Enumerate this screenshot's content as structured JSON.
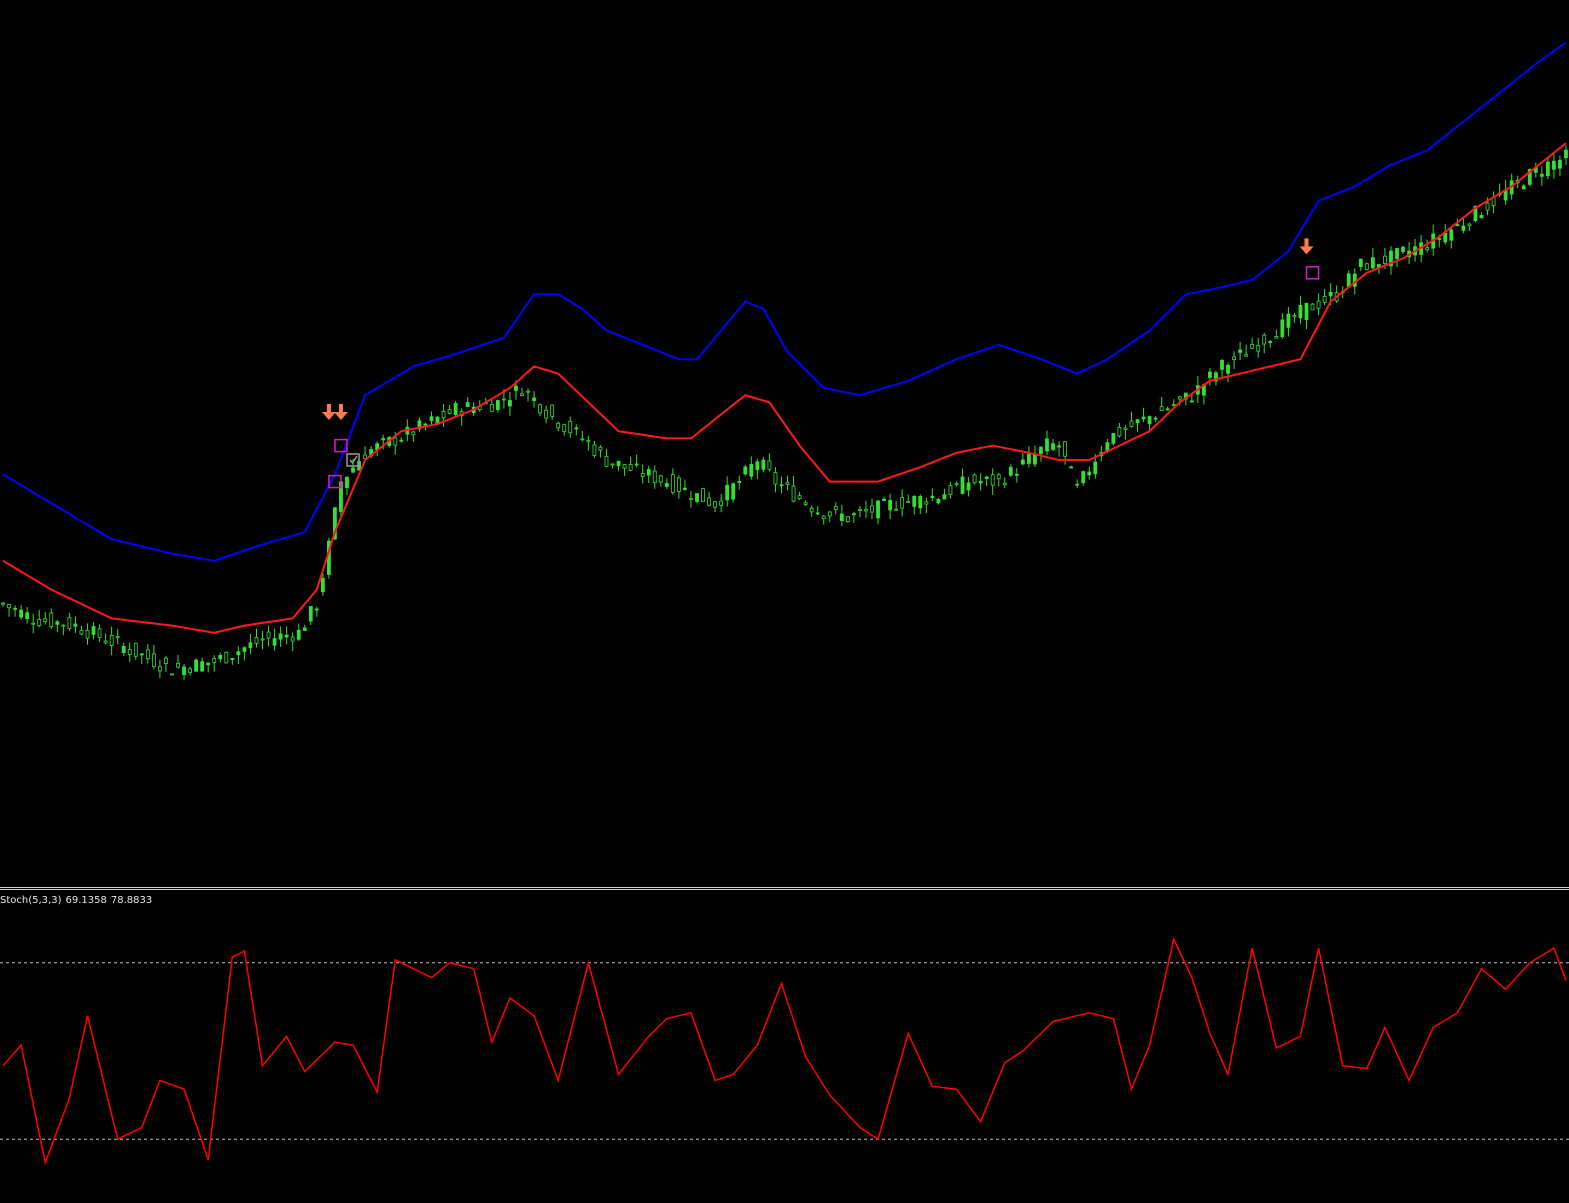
{
  "colors": {
    "background": "#000000",
    "upper_band": "#0000ff",
    "lower_band": "#ff1a1a",
    "candles": "#33e033",
    "sell_arrow": "#ff7a50",
    "marker_magenta": "#d020c8",
    "marker_check": "#9a9a9a",
    "stoch_line": "#ff0000",
    "stoch_levels": "#bfbfbf"
  },
  "stoch_label": {
    "name": "Stoch(5,3,3)",
    "main": "69.1358",
    "signal": "78.8833"
  },
  "chart_data": [
    {
      "type": "candlestick",
      "title": "",
      "grid": false,
      "bar_count": 260,
      "ylim": [
        0,
        100
      ],
      "close_path": [
        [
          0,
          30
        ],
        [
          5,
          28
        ],
        [
          12,
          27
        ],
        [
          20,
          24
        ],
        [
          28,
          21
        ],
        [
          35,
          22
        ],
        [
          43,
          25
        ],
        [
          49,
          26
        ],
        [
          52,
          30
        ],
        [
          54,
          38
        ],
        [
          56,
          47
        ],
        [
          60,
          51
        ],
        [
          68,
          54
        ],
        [
          75,
          57
        ],
        [
          82,
          58
        ],
        [
          86,
          60
        ],
        [
          91,
          56
        ],
        [
          96,
          53
        ],
        [
          100,
          50
        ],
        [
          103,
          49
        ],
        [
          110,
          47
        ],
        [
          115,
          45
        ],
        [
          118,
          44
        ],
        [
          122,
          47
        ],
        [
          125,
          50
        ],
        [
          128,
          47
        ],
        [
          135,
          43
        ],
        [
          140,
          42
        ],
        [
          148,
          44
        ],
        [
          155,
          45
        ],
        [
          160,
          47
        ],
        [
          165,
          47
        ],
        [
          170,
          50
        ],
        [
          173,
          52
        ],
        [
          175,
          52
        ],
        [
          178,
          46
        ],
        [
          183,
          53
        ],
        [
          190,
          56
        ],
        [
          197,
          59
        ],
        [
          202,
          63
        ],
        [
          206,
          65
        ],
        [
          211,
          68
        ],
        [
          216,
          71
        ],
        [
          221,
          73
        ],
        [
          225,
          77
        ],
        [
          230,
          78
        ],
        [
          236,
          80
        ],
        [
          242,
          83
        ],
        [
          247,
          86
        ],
        [
          252,
          89
        ],
        [
          256,
          91
        ],
        [
          259,
          92
        ]
      ],
      "upper_band": [
        [
          0,
          48
        ],
        [
          8,
          44
        ],
        [
          18,
          39
        ],
        [
          28,
          37
        ],
        [
          35,
          36
        ],
        [
          42,
          38
        ],
        [
          50,
          40
        ],
        [
          55,
          48
        ],
        [
          60,
          59
        ],
        [
          68,
          63
        ],
        [
          76,
          65
        ],
        [
          83,
          67
        ],
        [
          88,
          73
        ],
        [
          92,
          73
        ],
        [
          96,
          71
        ],
        [
          100,
          68
        ],
        [
          106,
          66
        ],
        [
          112,
          64
        ],
        [
          115,
          64
        ],
        [
          120,
          69
        ],
        [
          123,
          72
        ],
        [
          126,
          71
        ],
        [
          130,
          65
        ],
        [
          136,
          60
        ],
        [
          142,
          59
        ],
        [
          150,
          61
        ],
        [
          158,
          64
        ],
        [
          165,
          66
        ],
        [
          172,
          64
        ],
        [
          178,
          62
        ],
        [
          183,
          64
        ],
        [
          190,
          68
        ],
        [
          196,
          73
        ],
        [
          202,
          74
        ],
        [
          207,
          75
        ],
        [
          213,
          79
        ],
        [
          218,
          86
        ],
        [
          224,
          88
        ],
        [
          230,
          91
        ],
        [
          236,
          93
        ],
        [
          242,
          97
        ],
        [
          248,
          101
        ],
        [
          254,
          105
        ],
        [
          259,
          108
        ]
      ],
      "lower_band": [
        [
          0,
          36
        ],
        [
          8,
          32
        ],
        [
          18,
          28
        ],
        [
          28,
          27
        ],
        [
          35,
          26
        ],
        [
          40,
          27
        ],
        [
          48,
          28
        ],
        [
          52,
          32
        ],
        [
          55,
          40
        ],
        [
          60,
          50
        ],
        [
          66,
          54
        ],
        [
          72,
          55
        ],
        [
          78,
          57
        ],
        [
          84,
          60
        ],
        [
          88,
          63
        ],
        [
          92,
          62
        ],
        [
          97,
          58
        ],
        [
          102,
          54
        ],
        [
          110,
          53
        ],
        [
          114,
          53
        ],
        [
          120,
          57
        ],
        [
          123,
          59
        ],
        [
          127,
          58
        ],
        [
          132,
          52
        ],
        [
          137,
          47
        ],
        [
          145,
          47
        ],
        [
          152,
          49
        ],
        [
          158,
          51
        ],
        [
          164,
          52
        ],
        [
          170,
          51
        ],
        [
          175,
          50
        ],
        [
          180,
          50
        ],
        [
          185,
          52
        ],
        [
          190,
          54
        ],
        [
          195,
          58
        ],
        [
          200,
          61
        ],
        [
          210,
          63
        ],
        [
          215,
          64
        ],
        [
          220,
          72
        ],
        [
          226,
          76
        ],
        [
          232,
          78
        ],
        [
          238,
          81
        ],
        [
          244,
          85
        ],
        [
          250,
          88
        ],
        [
          256,
          92
        ],
        [
          259,
          94
        ]
      ],
      "sell_signals": [
        {
          "bar": 54,
          "value": 55
        },
        {
          "bar": 56,
          "value": 55
        },
        {
          "bar": 216,
          "value": 78
        }
      ],
      "markers": [
        {
          "bar": 55,
          "value": 47,
          "kind": "square"
        },
        {
          "bar": 56,
          "value": 52,
          "kind": "square"
        },
        {
          "bar": 58,
          "value": 50,
          "kind": "check"
        },
        {
          "bar": 217,
          "value": 76,
          "kind": "square"
        }
      ]
    },
    {
      "type": "line",
      "title": "Stoch(5,3,3)",
      "ylim": [
        0,
        100
      ],
      "levels": [
        80,
        20
      ],
      "series": [
        {
          "name": "Stoch(5,3,3)",
          "values": [
            [
              0,
              45
            ],
            [
              3,
              52
            ],
            [
              7,
              12
            ],
            [
              11,
              34
            ],
            [
              14,
              62
            ],
            [
              19,
              20
            ],
            [
              23,
              24
            ],
            [
              26,
              40
            ],
            [
              30,
              37
            ],
            [
              34,
              13
            ],
            [
              38,
              82
            ],
            [
              40,
              84
            ],
            [
              43,
              45
            ],
            [
              47,
              55
            ],
            [
              50,
              43
            ],
            [
              55,
              53
            ],
            [
              58,
              52
            ],
            [
              62,
              36
            ],
            [
              65,
              81
            ],
            [
              68,
              78
            ],
            [
              71,
              75
            ],
            [
              74,
              80
            ],
            [
              78,
              78
            ],
            [
              81,
              53
            ],
            [
              84,
              68
            ],
            [
              88,
              62
            ],
            [
              92,
              40
            ],
            [
              97,
              80
            ],
            [
              102,
              42
            ],
            [
              107,
              55
            ],
            [
              110,
              61
            ],
            [
              114,
              63
            ],
            [
              118,
              40
            ],
            [
              121,
              42
            ],
            [
              125,
              52
            ],
            [
              129,
              73
            ],
            [
              133,
              48
            ],
            [
              137,
              35
            ],
            [
              142,
              24
            ],
            [
              145,
              20
            ],
            [
              150,
              56
            ],
            [
              154,
              38
            ],
            [
              158,
              37
            ],
            [
              162,
              26
            ],
            [
              166,
              46
            ],
            [
              169,
              50
            ],
            [
              174,
              60
            ],
            [
              180,
              63
            ],
            [
              184,
              61
            ],
            [
              187,
              37
            ],
            [
              190,
              52
            ],
            [
              194,
              88
            ],
            [
              197,
              75
            ],
            [
              200,
              56
            ],
            [
              203,
              42
            ],
            [
              207,
              85
            ],
            [
              211,
              51
            ],
            [
              215,
              55
            ],
            [
              218,
              85
            ],
            [
              222,
              45
            ],
            [
              226,
              44
            ],
            [
              229,
              58
            ],
            [
              233,
              40
            ],
            [
              237,
              58
            ],
            [
              241,
              63
            ],
            [
              245,
              78
            ],
            [
              249,
              71
            ],
            [
              253,
              80
            ],
            [
              257,
              85
            ],
            [
              259,
              74
            ]
          ]
        }
      ]
    }
  ]
}
